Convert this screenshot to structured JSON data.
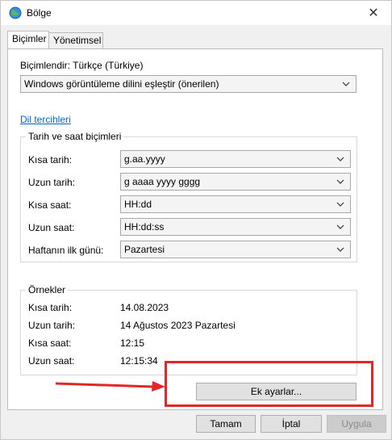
{
  "window": {
    "title": "Bölge"
  },
  "tabs": [
    {
      "label": "Biçimler"
    },
    {
      "label": "Yönetimsel"
    }
  ],
  "format": {
    "label": "Biçimlendir: Türkçe (Türkiye)",
    "dropdown_value": "Windows görüntüleme dilini eşleştir (önerilen)"
  },
  "language_prefs_link": "Dil tercihleri",
  "datetime_group": {
    "title": "Tarih ve saat biçimleri",
    "rows": [
      {
        "label": "Kısa tarih:",
        "value": "g.aa.yyyy"
      },
      {
        "label": "Uzun tarih:",
        "value": "g aaaa yyyy gggg"
      },
      {
        "label": "Kısa saat:",
        "value": "HH:dd"
      },
      {
        "label": "Uzun saat:",
        "value": "HH:dd:ss"
      },
      {
        "label": "Haftanın ilk günü:",
        "value": "Pazartesi"
      }
    ]
  },
  "examples_group": {
    "title": "Örnekler",
    "rows": [
      {
        "label": "Kısa tarih:",
        "value": "14.08.2023"
      },
      {
        "label": "Uzun tarih:",
        "value": "14 Ağustos 2023 Pazartesi"
      },
      {
        "label": "Kısa saat:",
        "value": "12:15"
      },
      {
        "label": "Uzun saat:",
        "value": "12:15:34"
      }
    ]
  },
  "buttons": {
    "additional": "Ek ayarlar...",
    "ok": "Tamam",
    "cancel": "İptal",
    "apply": "Uygula"
  },
  "colors": {
    "highlight": "#e32626",
    "link": "#0066cc"
  }
}
